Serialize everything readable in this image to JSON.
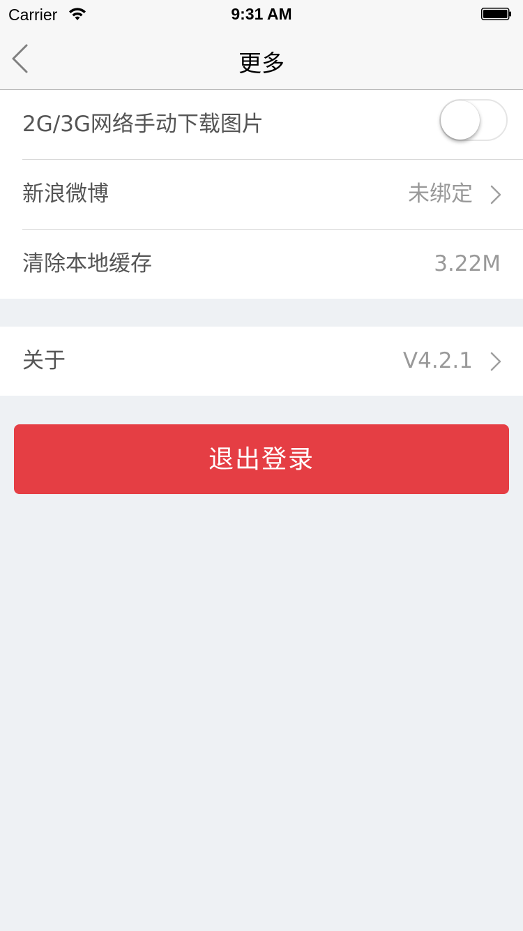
{
  "status_bar": {
    "carrier": "Carrier",
    "time": "9:31 AM",
    "wifi_icon": "wifi-icon",
    "battery_icon": "battery-full-icon"
  },
  "nav": {
    "title": "更多",
    "back_icon": "chevron-left-icon"
  },
  "settings": {
    "group1": [
      {
        "label": "2G/3G网络手动下载图片",
        "type": "toggle",
        "on": false
      },
      {
        "label": "新浪微博",
        "value": "未绑定",
        "type": "link"
      },
      {
        "label": "清除本地缓存",
        "value": "3.22M",
        "type": "value"
      }
    ],
    "group2": [
      {
        "label": "关于",
        "value": "V4.2.1",
        "type": "link"
      }
    ]
  },
  "logout_button": {
    "label": "退出登录",
    "color": "#e53e44"
  },
  "colors": {
    "background": "#eef1f4",
    "accent": "#e53e44",
    "nav_background": "#f7f7f7"
  }
}
